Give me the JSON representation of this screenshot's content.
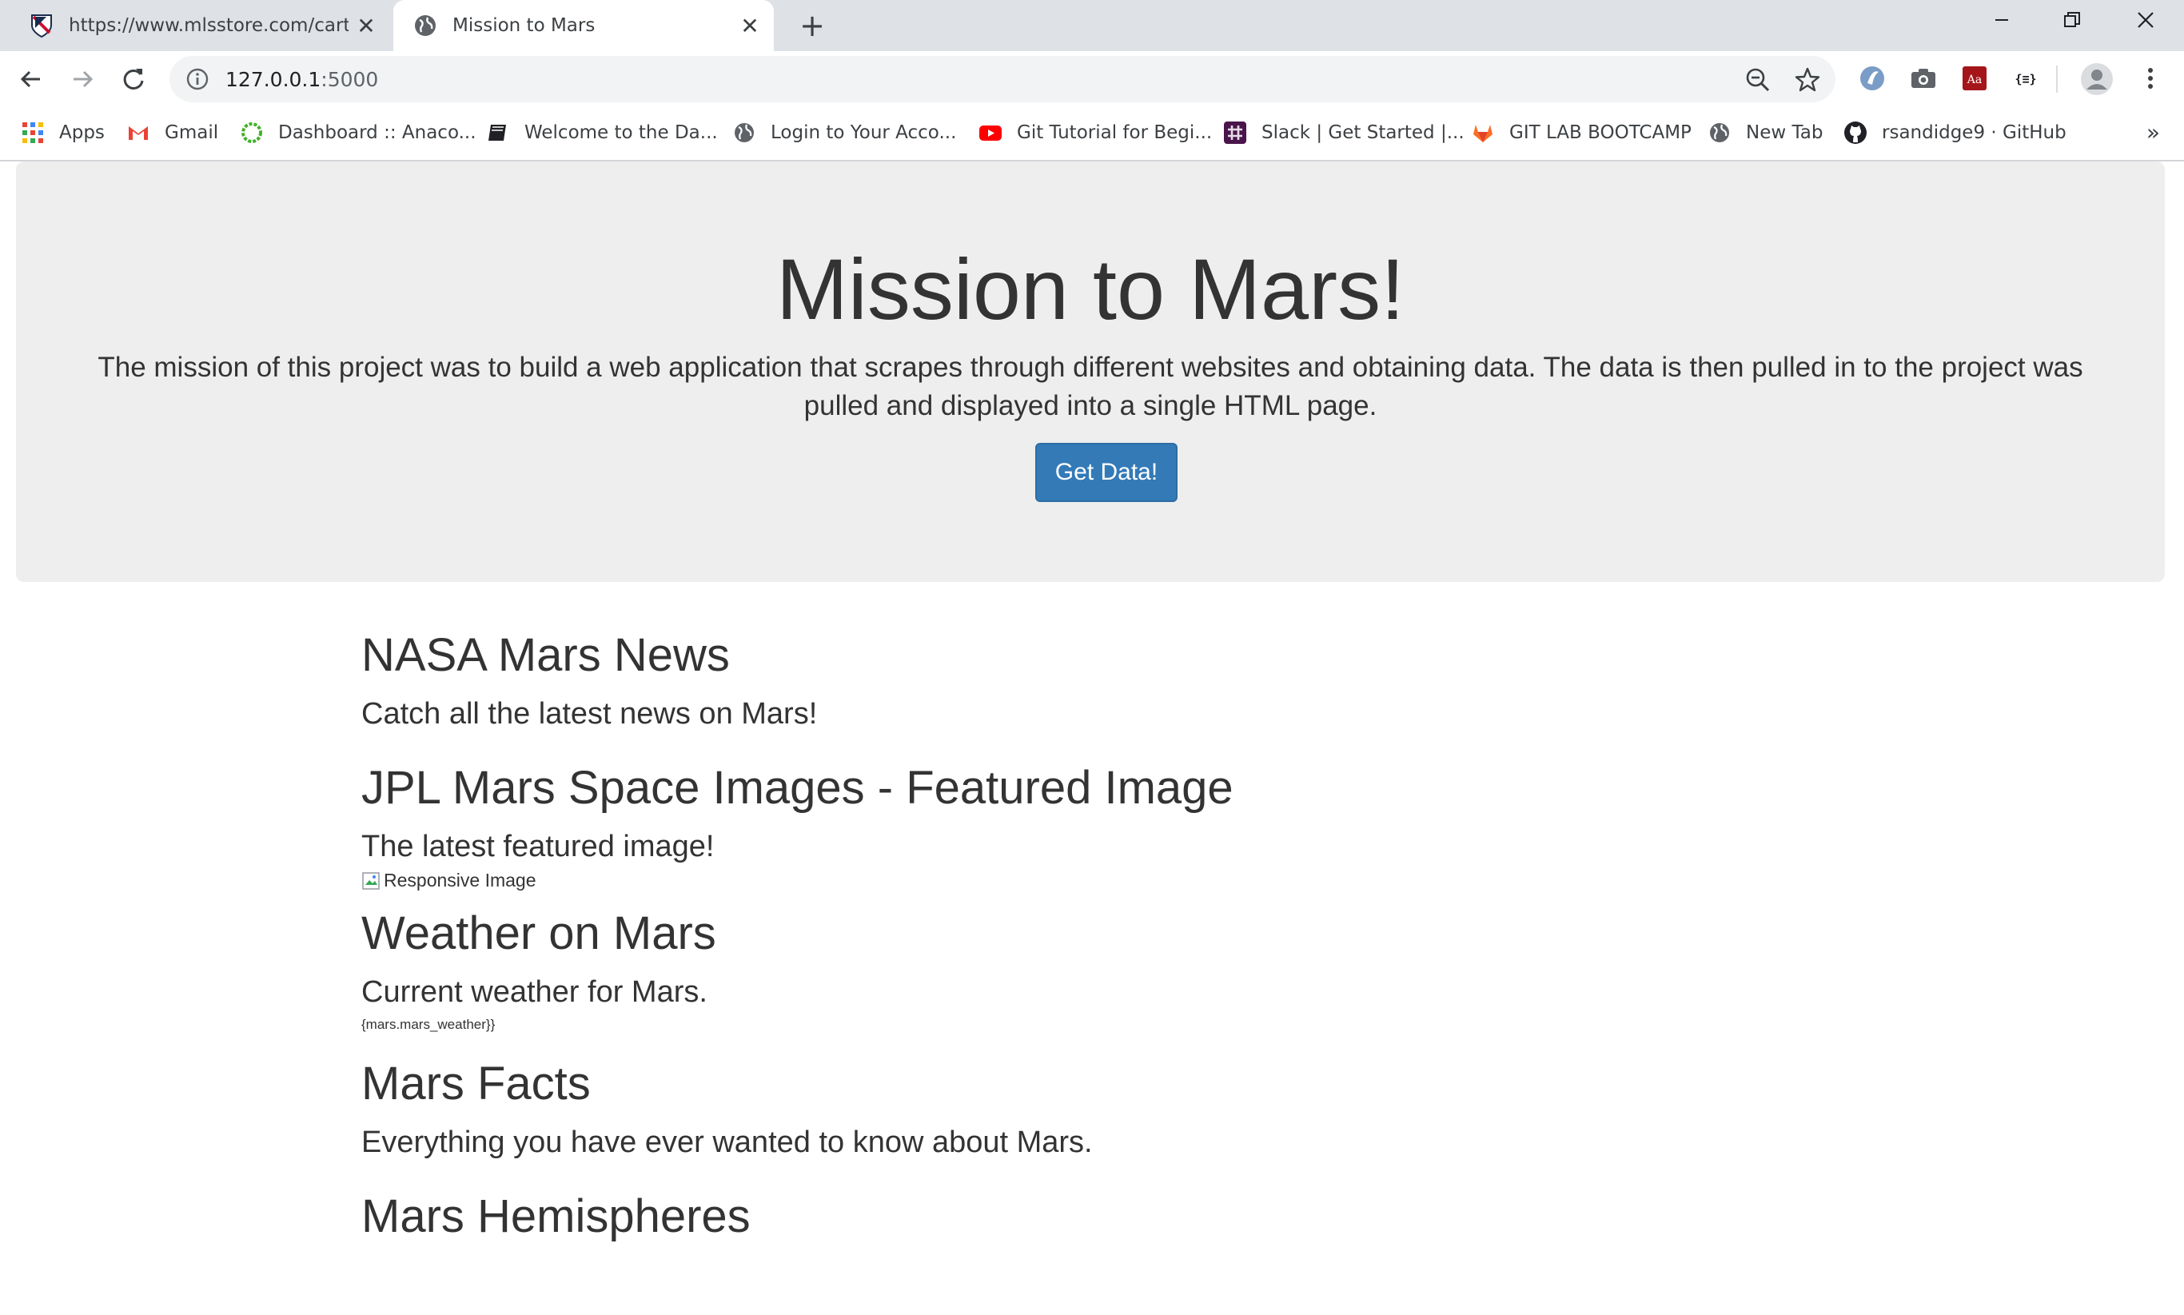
{
  "browser": {
    "tabs": [
      {
        "title": "https://www.mlsstore.com/cart",
        "active": false,
        "favicon": "mls-shield-icon"
      },
      {
        "title": "Mission to Mars",
        "active": true,
        "favicon": "globe-icon"
      }
    ],
    "new_tab_label": "+",
    "address": {
      "host": "127.0.0.1",
      "port": ":5000"
    },
    "bookmarks": [
      {
        "label": "Apps",
        "icon": "apps-grid-icon"
      },
      {
        "label": "Gmail",
        "icon": "gmail-icon"
      },
      {
        "label": "Dashboard :: Anaco...",
        "icon": "anaconda-icon"
      },
      {
        "label": "Welcome to the Da...",
        "icon": "book-icon"
      },
      {
        "label": "Login to Your Acco...",
        "icon": "globe-icon"
      },
      {
        "label": "Git Tutorial for Begi...",
        "icon": "youtube-icon"
      },
      {
        "label": "Slack | Get Started |...",
        "icon": "slack-icon"
      },
      {
        "label": "GIT LAB BOOTCAMP",
        "icon": "gitlab-icon"
      },
      {
        "label": "New Tab",
        "icon": "globe-icon"
      },
      {
        "label": "rsandidge9 · GitHub",
        "icon": "github-icon"
      }
    ],
    "bookmarks_overflow": "»",
    "colors": {
      "tabstrip": "#dee1e6",
      "omnibox": "#f1f3f4"
    }
  },
  "page": {
    "jumbotron": {
      "title": "Mission to Mars!",
      "description": "The mission of this project was to build a web application that scrapes through different websites and obtaining data. The data is then pulled in to the project was pulled and displayed into a single HTML page.",
      "button_label": "Get Data!",
      "button_color": "#337ab7"
    },
    "sections": {
      "news": {
        "heading": "NASA Mars News",
        "subheading": "Catch all the latest news on Mars!"
      },
      "images": {
        "heading": "JPL Mars Space Images - Featured Image",
        "subheading": "The latest featured image!",
        "image_alt": "Responsive Image"
      },
      "weather": {
        "heading": "Weather on Mars",
        "subheading": "Current weather for Mars.",
        "value": "{mars.mars_weather}}"
      },
      "facts": {
        "heading": "Mars Facts",
        "subheading": "Everything you have ever wanted to know about Mars."
      },
      "hemispheres": {
        "heading": "Mars Hemispheres"
      }
    }
  }
}
